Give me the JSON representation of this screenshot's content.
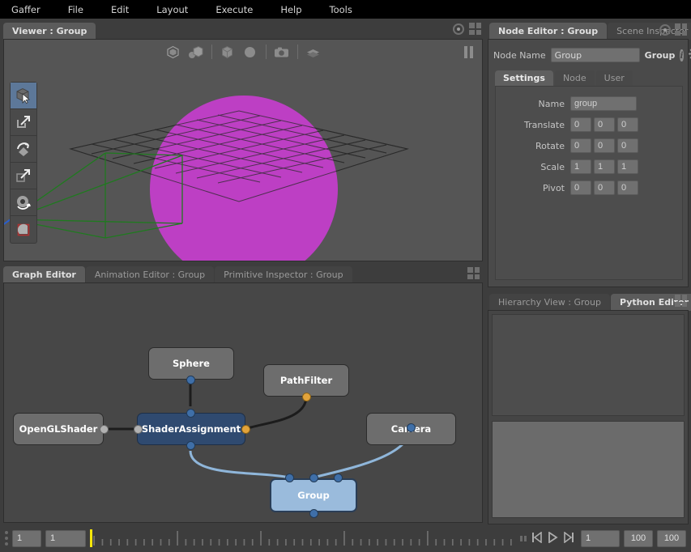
{
  "menubar": {
    "items": [
      {
        "label": "Gaffer"
      },
      {
        "label": "File"
      },
      {
        "label": "Edit"
      },
      {
        "label": "Layout"
      },
      {
        "label": "Execute"
      },
      {
        "label": "Help"
      },
      {
        "label": "Tools"
      }
    ]
  },
  "viewer": {
    "tabs": [
      {
        "label": "Viewer : Group",
        "active": true
      }
    ],
    "toolbar_top": [
      {
        "name": "bounding-box-icon"
      },
      {
        "name": "shaded-objects-icon"
      },
      {
        "name": "cube-primitive-icon"
      },
      {
        "name": "sphere-primitive-icon"
      },
      {
        "name": "camera-icon"
      },
      {
        "name": "layers-icon"
      }
    ],
    "toolbar_left": [
      {
        "name": "select-tool",
        "active": true
      },
      {
        "name": "translate-tool",
        "active": false
      },
      {
        "name": "rotate-tool",
        "active": false
      },
      {
        "name": "scale-tool",
        "active": false
      },
      {
        "name": "camera-tool",
        "active": false
      },
      {
        "name": "crop-window-tool",
        "active": false
      }
    ],
    "pause_label": "pause",
    "scene_colors": {
      "background": "#555555",
      "sphere": "#bd3fc4",
      "frustum": "#1e6b1e",
      "grid": "#3a3a3a",
      "axis_x": "#cc2222",
      "axis_y": "#22aa33",
      "axis_z": "#2255cc"
    }
  },
  "graph_editor": {
    "tabs": [
      {
        "label": "Graph Editor",
        "active": true
      },
      {
        "label": "Animation Editor : Group",
        "active": false
      },
      {
        "label": "Primitive Inspector : Group",
        "active": false
      }
    ],
    "nodes": [
      {
        "label": "Sphere",
        "style": "plain"
      },
      {
        "label": "PathFilter",
        "style": "plain"
      },
      {
        "label": "OpenGLShader",
        "style": "plain"
      },
      {
        "label": "ShaderAssignment",
        "style": "sel-dark"
      },
      {
        "label": "Camera",
        "style": "plain"
      },
      {
        "label": "Group",
        "style": "sel-light"
      }
    ]
  },
  "node_editor": {
    "tabs": [
      {
        "label": "Node Editor : Group",
        "active": true
      },
      {
        "label": "Scene Inspector",
        "active": false
      }
    ],
    "node_name_label": "Node Name",
    "node_name_value": "Group",
    "node_type_label": "Group",
    "inner_tabs": [
      {
        "label": "Settings",
        "active": true
      },
      {
        "label": "Node",
        "active": false
      },
      {
        "label": "User",
        "active": false
      }
    ],
    "params": [
      {
        "label": "Name",
        "values": [
          "group"
        ],
        "wide": true
      },
      {
        "label": "Translate",
        "values": [
          "0",
          "0",
          "0"
        ],
        "wide": false
      },
      {
        "label": "Rotate",
        "values": [
          "0",
          "0",
          "0"
        ],
        "wide": false
      },
      {
        "label": "Scale",
        "values": [
          "1",
          "1",
          "1"
        ],
        "wide": false
      },
      {
        "label": "Pivot",
        "values": [
          "0",
          "0",
          "0"
        ],
        "wide": false
      }
    ]
  },
  "python_editor": {
    "tabs": [
      {
        "label": "Hierarchy View : Group",
        "active": false
      },
      {
        "label": "Python Editor",
        "active": true
      }
    ],
    "output_text": "",
    "input_text": ""
  },
  "timeline": {
    "start_frame": "1",
    "current_frame": "1",
    "playback_frame": "1",
    "end_frame": "100",
    "range_end": "100",
    "transport": [
      {
        "name": "skip-to-start-icon"
      },
      {
        "name": "play-icon"
      },
      {
        "name": "skip-to-end-icon"
      }
    ],
    "playhead_color": "#f5e60a"
  }
}
